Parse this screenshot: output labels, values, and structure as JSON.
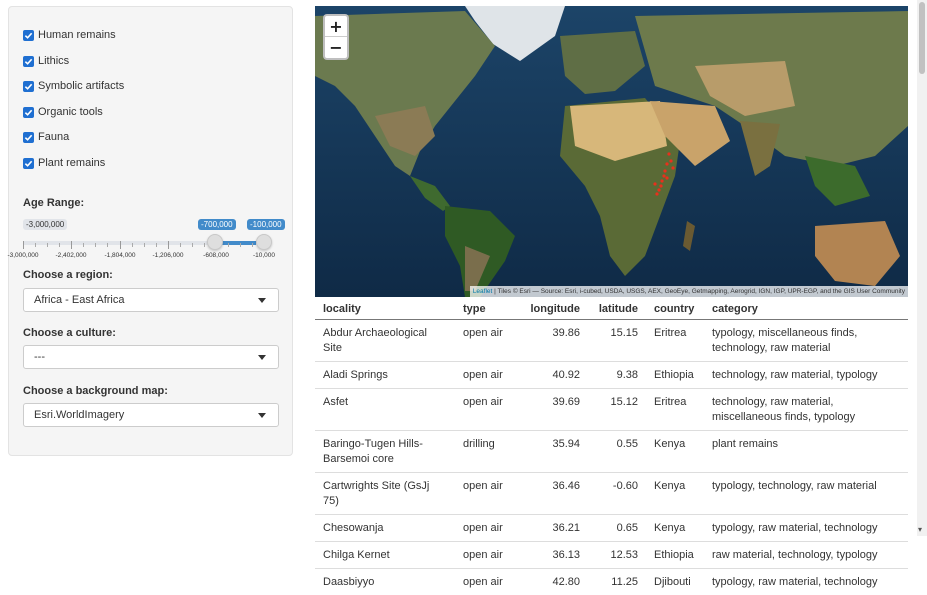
{
  "filters": {
    "checkboxes": [
      {
        "label": "Human remains",
        "checked": true
      },
      {
        "label": "Lithics",
        "checked": true
      },
      {
        "label": "Symbolic artifacts",
        "checked": true
      },
      {
        "label": "Organic tools",
        "checked": true
      },
      {
        "label": "Fauna",
        "checked": true
      },
      {
        "label": "Plant remains",
        "checked": true
      }
    ],
    "age_range": {
      "label": "Age Range:",
      "min_label": "-3,000,000",
      "from_value": "-700,000",
      "to_value": "-100,000",
      "ticks": [
        "-3,000,000",
        "-2,402,000",
        "-1,804,000",
        "-1,206,000",
        "-608,000",
        "-10,000"
      ]
    },
    "region": {
      "label": "Choose a region:",
      "value": "Africa - East Africa"
    },
    "culture": {
      "label": "Choose a culture:",
      "value": "---"
    },
    "background_map": {
      "label": "Choose a background map:",
      "value": "Esri.WorldImagery"
    }
  },
  "map": {
    "zoom_in": "+",
    "zoom_out": "−",
    "attribution_link": "Leaflet",
    "attribution_text": " | Tiles © Esri — Source: Esri, i-cubed, USDA, USGS, AEX, GeoEye, Getmapping, Aerogrid, IGN, IGP, UPR-EGP, and the GIS User Community",
    "marker_color": "#e8301c"
  },
  "table": {
    "headers": [
      "locality",
      "type",
      "longitude",
      "latitude",
      "country",
      "category"
    ],
    "rows": [
      [
        "Abdur Archaeological Site",
        "open air",
        "39.86",
        "15.15",
        "Eritrea",
        "typology, miscellaneous finds, technology, raw material"
      ],
      [
        "Aladi Springs",
        "open air",
        "40.92",
        "9.38",
        "Ethiopia",
        "technology, raw material, typology"
      ],
      [
        "Asfet",
        "open air",
        "39.69",
        "15.12",
        "Eritrea",
        "technology, raw material, miscellaneous finds, typology"
      ],
      [
        "Baringo-Tugen Hills-Barsemoi core",
        "drilling",
        "35.94",
        "0.55",
        "Kenya",
        "plant remains"
      ],
      [
        "Cartwrights Site (GsJj 75)",
        "open air",
        "36.46",
        "-0.60",
        "Kenya",
        "typology, technology, raw material"
      ],
      [
        "Chesowanja",
        "open air",
        "36.21",
        "0.65",
        "Kenya",
        "typology, raw material, technology"
      ],
      [
        "Chilga Kernet",
        "open air",
        "36.13",
        "12.53",
        "Ethiopia",
        "raw material, technology, typology"
      ],
      [
        "Daasbiyyo",
        "open air",
        "42.80",
        "11.25",
        "Djibouti",
        "typology, raw material, technology"
      ]
    ]
  }
}
